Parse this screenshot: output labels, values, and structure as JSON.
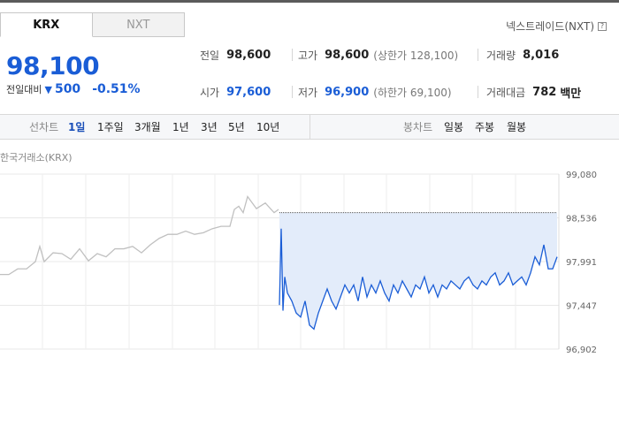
{
  "market_tabs": [
    {
      "label": "KRX",
      "active": true
    },
    {
      "label": "NXT",
      "active": false
    }
  ],
  "nxt_link": "넥스트레이드(NXT)",
  "price": {
    "current": "98,100",
    "change_label": "전일대비",
    "change_value": "500",
    "change_percent": "-0.51%",
    "direction": "down"
  },
  "stats": {
    "prev_close": {
      "label": "전일",
      "value": "98,600"
    },
    "high": {
      "label": "고가",
      "value": "98,600",
      "sub": "(상한가 128,100)"
    },
    "volume": {
      "label": "거래량",
      "value": "8,016"
    },
    "open": {
      "label": "시가",
      "value": "97,600"
    },
    "low": {
      "label": "저가",
      "value": "96,900",
      "sub": "(하한가 69,100)"
    },
    "amount": {
      "label": "거래대금",
      "value": "782",
      "unit": "백만"
    }
  },
  "line_chart_label": "선차트",
  "line_periods": [
    "1일",
    "1주일",
    "3개월",
    "1년",
    "3년",
    "5년",
    "10년"
  ],
  "active_period": "1일",
  "candle_chart_label": "봉차트",
  "candle_periods": [
    "일봉",
    "주봉",
    "월봉"
  ],
  "chart_caption": "한국거래소(KRX)",
  "colors": {
    "accent_blue": "#1a5dd6",
    "fill_blue": "#e3ecfa",
    "pre_market_gray": "#c0c0c0"
  },
  "chart_data": {
    "type": "line",
    "ylim": [
      96902,
      99080
    ],
    "y_ticks": [
      "99,080",
      "98,536",
      "97,991",
      "97,447",
      "96,902"
    ],
    "reference_value": 98600,
    "series": [
      {
        "segment": "pre-market",
        "x": [
          0,
          10,
          20,
          30,
          40,
          45,
          50,
          60,
          70,
          80,
          90,
          100,
          110,
          120,
          130,
          140,
          150,
          160,
          170,
          180,
          190,
          200,
          210,
          220,
          230,
          240,
          250,
          260,
          265,
          270,
          275,
          280,
          290,
          300,
          310,
          315
        ],
        "y": [
          97830,
          97830,
          97900,
          97900,
          97990,
          98180,
          97990,
          98100,
          98090,
          98020,
          98150,
          98000,
          98090,
          98050,
          98150,
          98150,
          98180,
          98100,
          98200,
          98280,
          98330,
          98330,
          98370,
          98330,
          98350,
          98400,
          98430,
          98430,
          98640,
          98680,
          98600,
          98800,
          98650,
          98720,
          98600,
          98640
        ]
      },
      {
        "segment": "regular",
        "x": [
          316,
          318,
          320,
          322,
          325,
          330,
          335,
          340,
          345,
          350,
          355,
          360,
          365,
          370,
          375,
          380,
          385,
          390,
          395,
          400,
          405,
          410,
          415,
          420,
          425,
          430,
          435,
          440,
          445,
          450,
          455,
          460,
          465,
          470,
          475,
          480,
          485,
          490,
          495,
          500,
          505,
          510,
          515,
          520,
          525,
          530,
          535,
          540,
          545,
          550,
          555,
          560,
          565,
          570,
          575,
          580,
          585,
          590,
          595,
          600,
          605,
          610,
          615,
          620,
          625,
          630
        ],
        "y": [
          97450,
          98400,
          97380,
          97800,
          97600,
          97500,
          97350,
          97300,
          97500,
          97200,
          97150,
          97350,
          97500,
          97650,
          97500,
          97400,
          97550,
          97700,
          97600,
          97700,
          97500,
          97800,
          97550,
          97700,
          97600,
          97750,
          97600,
          97500,
          97700,
          97600,
          97750,
          97650,
          97550,
          97700,
          97650,
          97800,
          97600,
          97700,
          97550,
          97700,
          97650,
          97750,
          97700,
          97650,
          97750,
          97800,
          97700,
          97650,
          97750,
          97700,
          97800,
          97850,
          97700,
          97750,
          97850,
          97700,
          97750,
          97800,
          97700,
          97850,
          98050,
          97950,
          98200,
          97900,
          97900,
          98050
        ]
      }
    ]
  }
}
